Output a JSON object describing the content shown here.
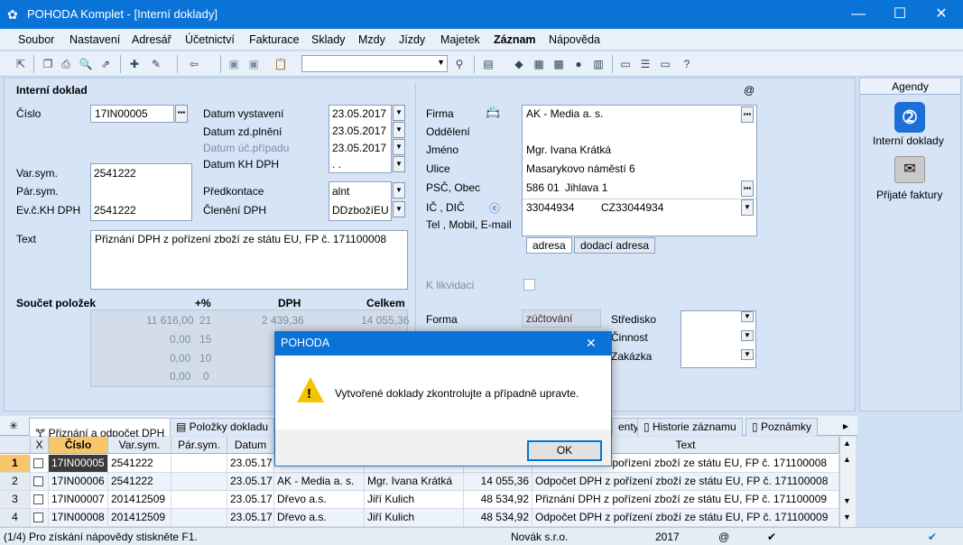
{
  "window": {
    "title": "POHODA Komplet - [Interní doklady]",
    "minimize": "—",
    "maximize": "☐",
    "close": "✕"
  },
  "menu": [
    "Soubor",
    "Nastavení",
    "Adresář",
    "Účetnictví",
    "Fakturace",
    "Sklady",
    "Mzdy",
    "Jízdy",
    "Majetek",
    "Záznam",
    "Nápověda"
  ],
  "form": {
    "section_title": "Interní doklad",
    "at": "@",
    "cislo_label": "Číslo",
    "cislo": "17IN00005",
    "datum_vystaveni_label": "Datum vystavení",
    "datum_vystaveni": "23.05.2017",
    "datum_zd_label": "Datum zd.plnění",
    "datum_zd": "23.05.2017",
    "datum_uc_label": "Datum úč.případu",
    "datum_uc": "23.05.2017",
    "datum_kh_label": "Datum KH DPH",
    "datum_kh": " .  .",
    "varsym_label": "Var.sym.",
    "varsym": "2541222",
    "parsym_label": "Pár.sym.",
    "evc_label": "Ev.č.KH DPH",
    "evc": "2541222",
    "predkontace_label": "Předkontace",
    "predkontace": "alnt",
    "cleneni_label": "Členění DPH",
    "cleneni": "DDzbožíEU",
    "text_label": "Text",
    "text": "Přiznání DPH z pořízení zboží ze státu EU, FP č. 171100008",
    "soucet_label": "Součet položek",
    "col_pct": "+%",
    "col_dph": "DPH",
    "col_celkem": "Celkem",
    "rows": [
      {
        "base": "11 616,00",
        "pct": "21",
        "dph": "2 439,36",
        "celkem": "14 055,36"
      },
      {
        "base": "0,00",
        "pct": "15",
        "dph": "0,00",
        "celkem": ""
      },
      {
        "base": "0,00",
        "pct": "10",
        "dph": "",
        "celkem": ""
      },
      {
        "base": "0,00",
        "pct": "0",
        "dph": "",
        "celkem": ""
      }
    ],
    "firma_label": "Firma",
    "firma": "AK - Media a. s.",
    "oddeleni_label": "Oddělení",
    "jmeno_label": "Jméno",
    "jmeno": "Mgr. Ivana Krátká",
    "ulice_label": "Ulice",
    "ulice": "Masarykovo náměstí 6",
    "psc_label": "PSČ, Obec",
    "psc": "586 01",
    "obec": "Jihlava 1",
    "ic_label": "IČ , DIČ",
    "ic": "33044934",
    "dic": "CZ33044934",
    "tel_label": "Tel , Mobil, E-mail",
    "tab_adresa": "adresa",
    "tab_dodaci": "dodací adresa",
    "k_likvidaci_label": "K likvidaci",
    "forma_label": "Forma",
    "forma": "zúčtování",
    "stredisko_label": "Středisko",
    "cinnost_label": "Činnost",
    "zakazka_label": "Zakázka"
  },
  "agendy": {
    "title": "Agendy",
    "items": [
      "Interní doklady",
      "Přijaté faktury"
    ]
  },
  "dialog": {
    "title": "POHODA",
    "message": "Vytvořené doklady zkontrolujte a případně upravte.",
    "ok": "OK",
    "close": "✕"
  },
  "tabs": [
    "Přiznání a odpočet DPH",
    "Položky dokladu",
    "enty",
    "Historie záznamu",
    "Poznámky"
  ],
  "grid": {
    "headers": [
      "X",
      "Číslo",
      "Var.sym.",
      "Pár.sym.",
      "Datum",
      "Text"
    ],
    "rows": [
      {
        "n": "1",
        "cislo": "17IN00005",
        "varsym": "2541222",
        "parsym": "",
        "datum": "23.05.17",
        "firma": "",
        "jmeno": "",
        "castka": "",
        "text": "Přiznání DPH z pořízení zboží ze státu EU, FP č. 171100008"
      },
      {
        "n": "2",
        "cislo": "17IN00006",
        "varsym": "2541222",
        "parsym": "",
        "datum": "23.05.17",
        "firma": "AK - Media a. s.",
        "jmeno": "Mgr. Ivana Krátká",
        "castka": "14 055,36",
        "text": "Odpočet DPH z pořízení zboží ze státu EU, FP č. 171100008"
      },
      {
        "n": "3",
        "cislo": "17IN00007",
        "varsym": "201412509",
        "parsym": "",
        "datum": "23.05.17",
        "firma": "Dřevo a.s.",
        "jmeno": "Jiří Kulich",
        "castka": "48 534,92",
        "text": "Přiznání DPH z pořízení zboží ze státu EU, FP č. 171100009"
      },
      {
        "n": "4",
        "cislo": "17IN00008",
        "varsym": "201412509",
        "parsym": "",
        "datum": "23.05.17",
        "firma": "Dřevo a.s.",
        "jmeno": "Jiří Kulich",
        "castka": "48 534,92",
        "text": "Odpočet DPH z pořízení zboží ze státu EU, FP č. 171100009"
      }
    ]
  },
  "status": {
    "hint": "(1/4) Pro získání nápovědy stiskněte F1.",
    "company": "Novák s.r.o.",
    "year": "2017",
    "at": "@"
  }
}
